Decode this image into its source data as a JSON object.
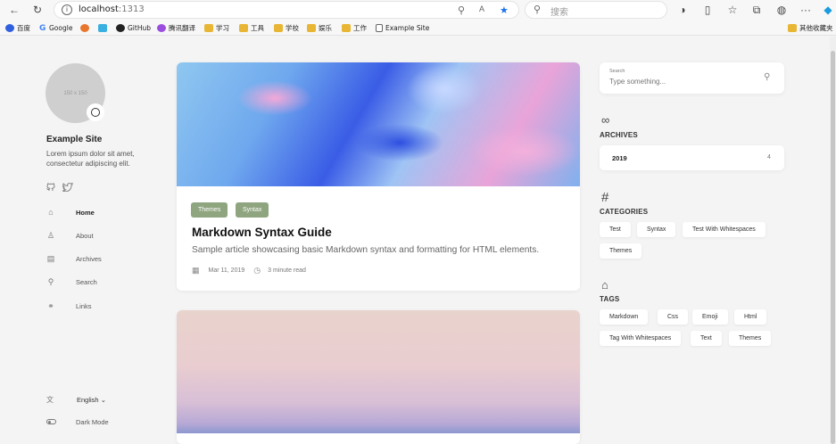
{
  "browser": {
    "url_host": "localhost",
    "url_port": ":1313",
    "search_placeholder": "搜索",
    "bookmarks": [
      "百度",
      "Google",
      "GitHub",
      "腾讯翻译",
      "学习",
      "工具",
      "学校",
      "娱乐",
      "工作",
      "Example Site"
    ],
    "other_bookmarks": "其他收藏夹"
  },
  "sidebar": {
    "avatar_text": "150 x 150",
    "site_title": "Example Site",
    "site_desc": "Lorem ipsum dolor sit amet, consectetur adipiscing elit.",
    "nav": [
      {
        "label": "Home",
        "icon": "home-icon"
      },
      {
        "label": "About",
        "icon": "user-icon"
      },
      {
        "label": "Archives",
        "icon": "archive-icon"
      },
      {
        "label": "Search",
        "icon": "search-icon"
      },
      {
        "label": "Links",
        "icon": "link-icon"
      }
    ],
    "language": "English",
    "dark_mode": "Dark Mode"
  },
  "posts": [
    {
      "tags": [
        "Themes",
        "Syntax"
      ],
      "title": "Markdown Syntax Guide",
      "description": "Sample article showcasing basic Markdown syntax and formatting for HTML elements.",
      "date": "Mar 11, 2019",
      "read_time": "3 minute read"
    }
  ],
  "widgets": {
    "search_label": "Search",
    "search_placeholder": "Type something...",
    "archives_title": "ARCHIVES",
    "archives": [
      {
        "year": "2019",
        "count": "4"
      }
    ],
    "categories_title": "CATEGORIES",
    "categories": [
      "Test",
      "Syntax",
      "Test With Whitespaces",
      "Themes"
    ],
    "tags_title": "TAGS",
    "tags": [
      "Markdown",
      "Css",
      "Emoji",
      "Html",
      "Tag With Whitespaces",
      "Text",
      "Themes"
    ]
  },
  "colors": {
    "accent": "#8fa57f",
    "page_bg": "#f4f4f4",
    "star": "#1a73e8"
  }
}
